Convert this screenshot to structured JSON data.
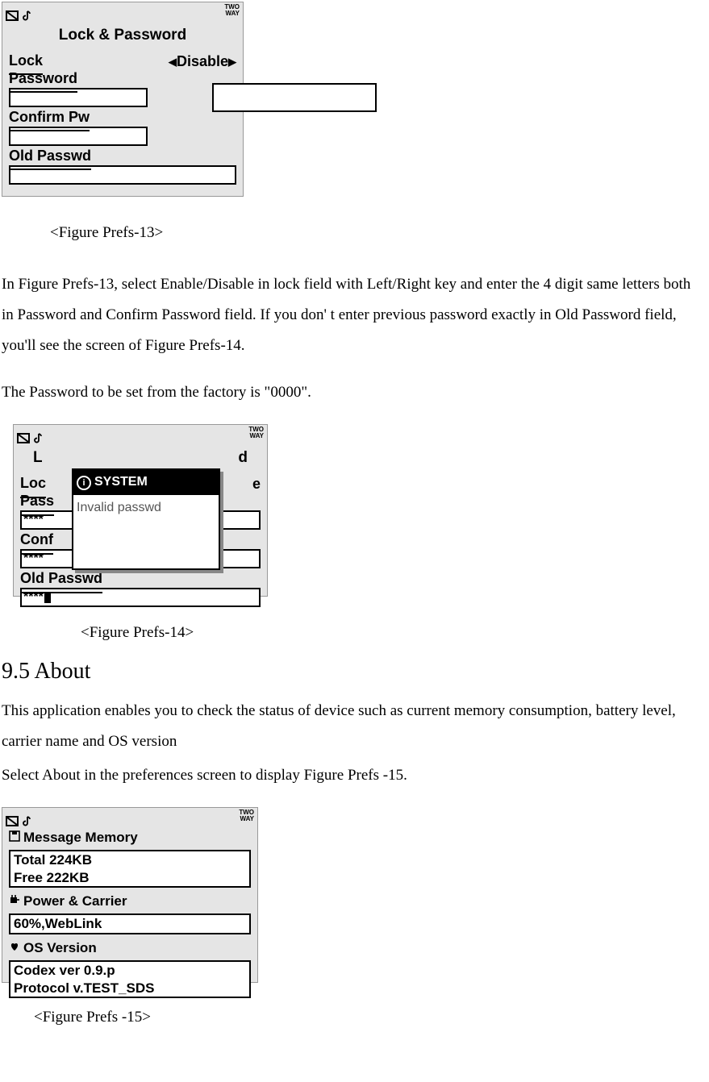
{
  "fig13": {
    "title": "Lock & Password",
    "two_way": "TWO\nWAY",
    "lock_label": "Lock",
    "lock_value": "Disable",
    "password_label": "Password",
    "password_value": "",
    "confirm_label": "Confirm Pw",
    "confirm_value": "",
    "old_label": "Old Passwd",
    "old_value": "",
    "caption": "<Figure Prefs-13>"
  },
  "para1": "In Figure Prefs-13, select Enable/Disable in lock field with Left/Right key and enter the 4 digit same letters both in Password and Confirm Password field. If you don' t enter previous password exactly in Old Password field, you'll see the screen of Figure Prefs-14.",
  "para2": "The Password to be set from the factory is \"0000\".",
  "fig14": {
    "title_left": "L",
    "title_right": "d",
    "two_way": "TWO\nWAY",
    "lock_label": "Loc",
    "lock_value_tail": "e",
    "password_label": "Pass",
    "password_value": "****",
    "confirm_label": "Conf",
    "confirm_value": "****",
    "old_label": "Old Passwd",
    "old_value": "****",
    "popup_title": "SYSTEM",
    "popup_body": "Invalid passwd",
    "caption": "<Figure Prefs-14>"
  },
  "section_heading": "9.5 About",
  "para3": "This application enables you to check the status of device such as current memory consumption, battery level, carrier name and OS version",
  "para4": "Select About in the preferences screen to display Figure Prefs -15.",
  "fig15": {
    "two_way": "TWO\nWAY",
    "mem_label": "Message Memory",
    "mem_total": "Total 224KB",
    "mem_free": "Free 222KB",
    "power_label": "Power & Carrier",
    "power_value": "60%,WebLink",
    "os_label": "OS Version",
    "os_line1": "Codex ver 0.9.p",
    "os_line2": "Protocol v.TEST_SDS",
    "caption": "<Figure Prefs -15>"
  }
}
